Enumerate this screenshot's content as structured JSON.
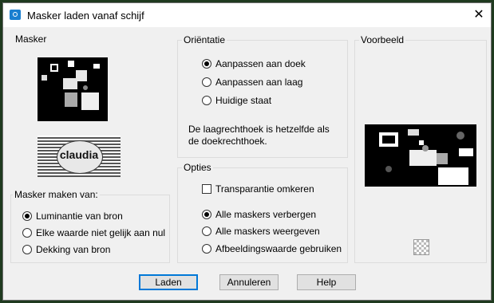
{
  "window": {
    "title": "Masker laden vanaf schijf",
    "close_glyph": "✕"
  },
  "masker": {
    "label": "Masker"
  },
  "masker_maken": {
    "label": "Masker maken van:",
    "options": [
      "Luminantie van bron",
      "Elke waarde niet gelijk aan nul",
      "Dekking van bron"
    ],
    "selected": 0
  },
  "orientatie": {
    "label": "Oriëntatie",
    "options": [
      "Aanpassen aan doek",
      "Aanpassen aan laag",
      "Huidige staat"
    ],
    "selected": 0,
    "note": "De laagrechthoek is hetzelfde als de doekrechthoek."
  },
  "opties": {
    "label": "Opties",
    "checkbox_label": "Transparantie omkeren",
    "checkbox_checked": false,
    "options": [
      "Alle maskers verbergen",
      "Alle maskers weergeven",
      "Afbeeldingswaarde gebruiken"
    ],
    "selected": 0
  },
  "voorbeeld": {
    "label": "Voorbeeld"
  },
  "buttons": {
    "load": "Laden",
    "cancel": "Annuleren",
    "help": "Help"
  },
  "logo": {
    "text": "claudia"
  }
}
